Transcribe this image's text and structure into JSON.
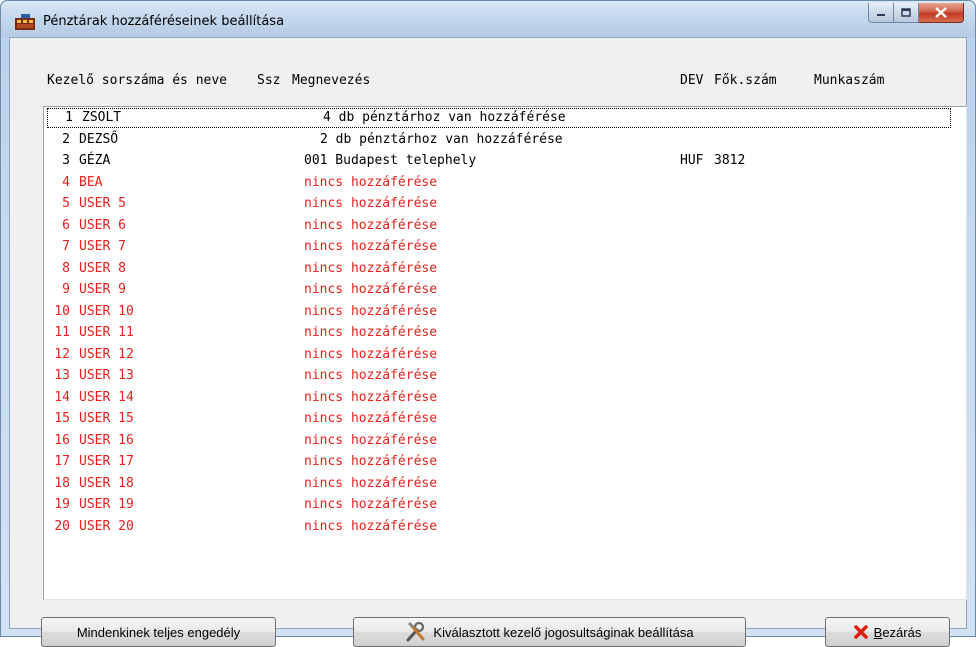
{
  "window": {
    "title": "Pénztárak hozzáféréseinek beállítása"
  },
  "header": {
    "col_operator": "Kezelő sorszáma és neve",
    "col_ssz": "Ssz",
    "col_name": "Megnevezés",
    "col_dev": "DEV",
    "col_main_account": "Fők.szám",
    "col_job_number": "Munkaszám"
  },
  "rows": [
    {
      "num": "1",
      "user": "ZSOLT",
      "access": "4 db pénztárhoz van hozzáférése",
      "dev": "",
      "account": "",
      "color": "#000000"
    },
    {
      "num": "2",
      "user": "DEZSŐ",
      "access": "2 db pénztárhoz van hozzáférése",
      "dev": "",
      "account": "",
      "color": "#000000"
    },
    {
      "num": "3",
      "user": "GÉZA",
      "access": "001 Budapest telephely",
      "dev": "HUF",
      "account": "3812",
      "color": "#000000"
    },
    {
      "num": "4",
      "user": "BEA",
      "access": "nincs hozzáférése",
      "dev": "",
      "account": "",
      "color": "#e8211d"
    },
    {
      "num": "5",
      "user": "USER 5",
      "access": "nincs hozzáférése",
      "dev": "",
      "account": "",
      "color": "#e8211d"
    },
    {
      "num": "6",
      "user": "USER 6",
      "access": "nincs hozzáférése",
      "dev": "",
      "account": "",
      "color": "#e8211d"
    },
    {
      "num": "7",
      "user": "USER 7",
      "access": "nincs hozzáférése",
      "dev": "",
      "account": "",
      "color": "#e8211d"
    },
    {
      "num": "8",
      "user": "USER 8",
      "access": "nincs hozzáférése",
      "dev": "",
      "account": "",
      "color": "#e8211d"
    },
    {
      "num": "9",
      "user": "USER 9",
      "access": "nincs hozzáférése",
      "dev": "",
      "account": "",
      "color": "#e8211d"
    },
    {
      "num": "10",
      "user": "USER 10",
      "access": "nincs hozzáférése",
      "dev": "",
      "account": "",
      "color": "#e8211d"
    },
    {
      "num": "11",
      "user": "USER 11",
      "access": "nincs hozzáférése",
      "dev": "",
      "account": "",
      "color": "#e8211d"
    },
    {
      "num": "12",
      "user": "USER 12",
      "access": "nincs hozzáférése",
      "dev": "",
      "account": "",
      "color": "#e8211d"
    },
    {
      "num": "13",
      "user": "USER 13",
      "access": "nincs hozzáférése",
      "dev": "",
      "account": "",
      "color": "#e8211d"
    },
    {
      "num": "14",
      "user": "USER 14",
      "access": "nincs hozzáférése",
      "dev": "",
      "account": "",
      "color": "#e8211d"
    },
    {
      "num": "15",
      "user": "USER 15",
      "access": "nincs hozzáférése",
      "dev": "",
      "account": "",
      "color": "#e8211d"
    },
    {
      "num": "16",
      "user": "USER 16",
      "access": "nincs hozzáférése",
      "dev": "",
      "account": "",
      "color": "#e8211d"
    },
    {
      "num": "17",
      "user": "USER 17",
      "access": "nincs hozzáférése",
      "dev": "",
      "account": "",
      "color": "#e8211d"
    },
    {
      "num": "18",
      "user": "USER 18",
      "access": "nincs hozzáférése",
      "dev": "",
      "account": "",
      "color": "#e8211d"
    },
    {
      "num": "19",
      "user": "USER 19",
      "access": "nincs hozzáférése",
      "dev": "",
      "account": "",
      "color": "#e8211d"
    },
    {
      "num": "20",
      "user": "USER 20",
      "access": "nincs hozzáférése",
      "dev": "",
      "account": "",
      "color": "#e8211d"
    }
  ],
  "buttons": {
    "grant_all": "Mindenkinek teljes engedély",
    "set_permissions": "Kiválasztott kezelő jogosultságinak beállítása",
    "close": "Bezárás"
  },
  "icons": {
    "app": "cash-register-icon",
    "set_permissions": "tools-icon",
    "close": "red-x-icon"
  }
}
